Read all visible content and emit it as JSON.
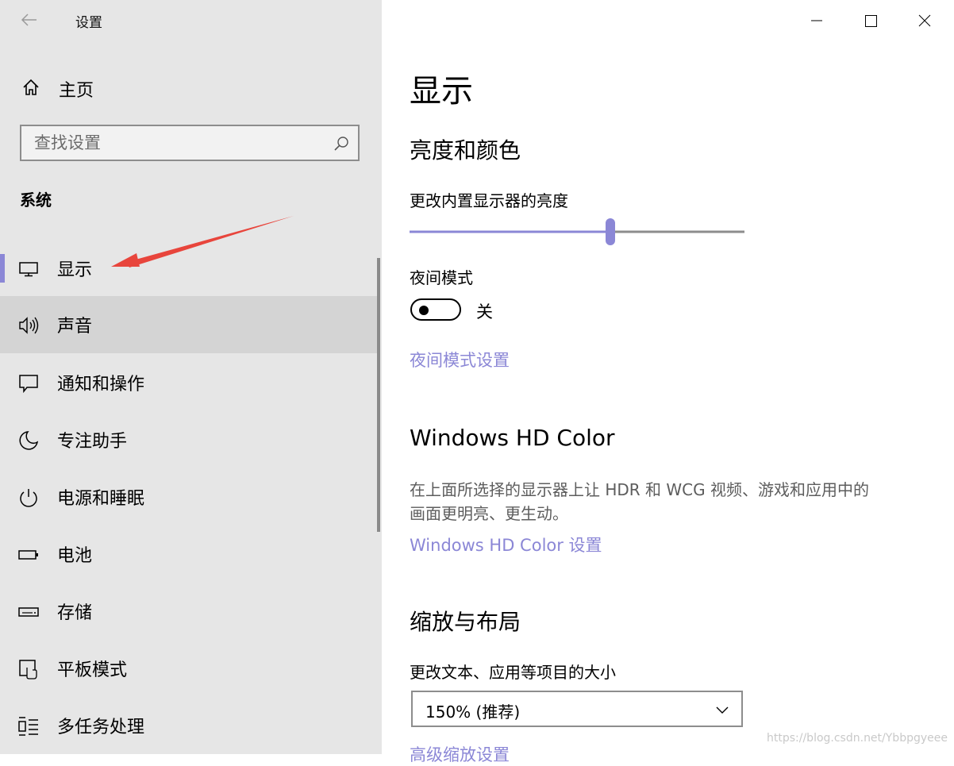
{
  "window": {
    "title": "设置"
  },
  "nav": {
    "home_label": "主页",
    "search_placeholder": "查找设置",
    "section_label": "系统",
    "items": [
      {
        "label": "显示",
        "icon": "monitor-icon",
        "selected": true
      },
      {
        "label": "声音",
        "icon": "speaker-icon",
        "hovered": true
      },
      {
        "label": "通知和操作",
        "icon": "notification-icon"
      },
      {
        "label": "专注助手",
        "icon": "moon-icon"
      },
      {
        "label": "电源和睡眠",
        "icon": "power-icon"
      },
      {
        "label": "电池",
        "icon": "battery-icon"
      },
      {
        "label": "存储",
        "icon": "storage-icon"
      },
      {
        "label": "平板模式",
        "icon": "tablet-mode-icon"
      },
      {
        "label": "多任务处理",
        "icon": "multitasking-icon"
      }
    ]
  },
  "main": {
    "page_title": "显示",
    "brightness": {
      "heading": "亮度和颜色",
      "slider_label": "更改内置显示器的亮度",
      "slider_value": 0.6
    },
    "night_light": {
      "label": "夜间模式",
      "state": "关",
      "enabled": false,
      "settings_link": "夜间模式设置"
    },
    "hd_color": {
      "heading": "Windows HD Color",
      "description_line1": "在上面所选择的显示器上让 HDR 和 WCG 视频、游戏和应用中的",
      "description_line2": "画面更明亮、更生动。",
      "link": "Windows HD Color 设置"
    },
    "scale": {
      "heading": "缩放与布局",
      "label": "更改文本、应用等项目的大小",
      "selected": "150% (推荐)",
      "advanced_link": "高级缩放设置"
    }
  },
  "watermark": "https://blog.csdn.net/Ybbpgyeee",
  "colors": {
    "accent": "#8b87d6",
    "nav_bg": "#e6e6e6",
    "hover_bg": "#d4d4d4",
    "annotation_arrow": "#e8453c"
  }
}
